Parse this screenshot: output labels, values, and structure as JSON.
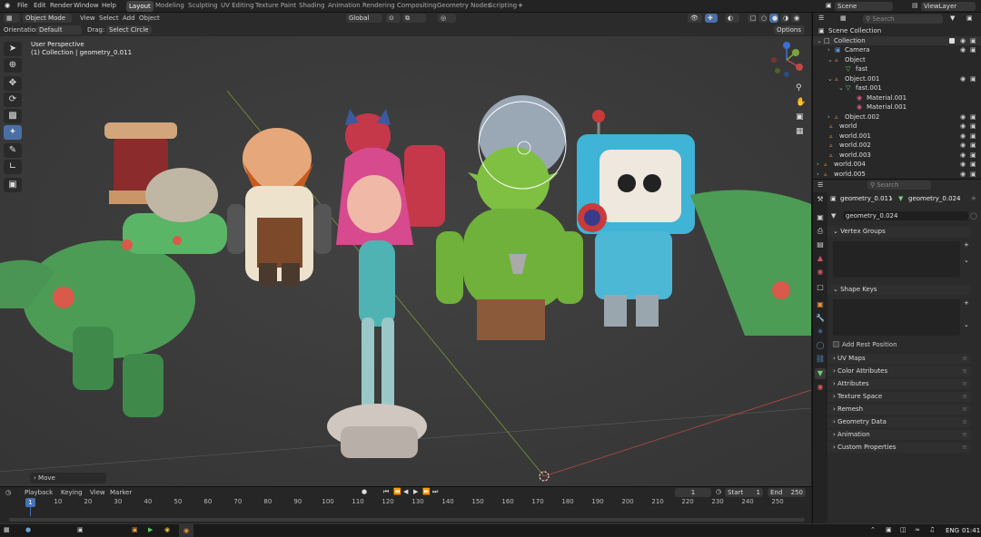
{
  "top_menu": {
    "file": "File",
    "edit": "Edit",
    "render": "Render",
    "window": "Window",
    "help": "Help"
  },
  "workspaces": [
    "Layout",
    "Modeling",
    "Sculpting",
    "UV Editing",
    "Texture Paint",
    "Shading",
    "Animation",
    "Rendering",
    "Compositing",
    "Geometry Nodes",
    "Scripting"
  ],
  "scene": "Scene",
  "view_layer": "ViewLayer",
  "header": {
    "mode": "Object Mode",
    "view": "View",
    "select": "Select",
    "add": "Add",
    "object": "Object",
    "transform": "Global"
  },
  "tool_settings": {
    "orientation_label": "Orientation:",
    "orientation": "Default",
    "drag_label": "Drag:",
    "drag": "Select Circle",
    "options": "Options"
  },
  "viewport": {
    "view_name": "User Perspective",
    "collection_info": "(1) Collection | geometry_0.011",
    "last_op": "Move"
  },
  "timeline": {
    "playback": "Playback",
    "keying": "Keying",
    "view": "View",
    "marker": "Marker",
    "current_frame": "1",
    "start_label": "Start",
    "start": "1",
    "end_label": "End",
    "end": "250",
    "frames": [
      "1",
      "10",
      "20",
      "30",
      "40",
      "50",
      "60",
      "70",
      "80",
      "90",
      "100",
      "110",
      "120",
      "130",
      "140",
      "150",
      "160",
      "170",
      "180",
      "190",
      "200",
      "210",
      "220",
      "230",
      "240",
      "250"
    ]
  },
  "outliner": {
    "search_placeholder": "Search",
    "rows": [
      "Scene Collection",
      "Collection",
      "Camera",
      "Object",
      "fast",
      "Object.001",
      "fast.001",
      "Material.001",
      "Material.001",
      "Object.002",
      "world",
      "world.001",
      "world.002",
      "world.003",
      "world.004",
      "world.005"
    ]
  },
  "properties": {
    "search_placeholder": "Search",
    "object_name": "geometry_0.011",
    "data_name": "geometry_0.024",
    "mesh_name": "geometry_0.024",
    "vertex_groups": "Vertex Groups",
    "shape_keys": "Shape Keys",
    "add_rest_position": "Add Rest Position",
    "panels": [
      "UV Maps",
      "Color Attributes",
      "Attributes",
      "Texture Space",
      "Remesh",
      "Geometry Data",
      "Animation",
      "Custom Properties"
    ]
  },
  "taskbar": {
    "lang": "ENG",
    "time": "01:41"
  },
  "colors": {
    "active_tool": "#4a6fa5",
    "playhead": "#4772b3",
    "x_axis": "#c04848",
    "y_axis": "#7fa33a",
    "z_axis": "#3d6fd0"
  }
}
